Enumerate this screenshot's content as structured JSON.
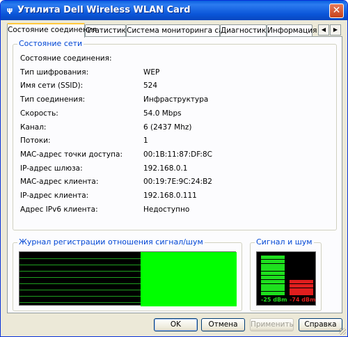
{
  "window": {
    "title": "Утилита Dell Wireless WLAN Card",
    "close_glyph": "✕",
    "app_icon_glyph": "ψ"
  },
  "tabs": [
    {
      "label": "Состояние соединения",
      "active": true
    },
    {
      "label": "Статистика",
      "active": false
    },
    {
      "label": "Система мониторинга сайта",
      "active": false
    },
    {
      "label": "Диагностика",
      "active": false
    },
    {
      "label": "Информация",
      "active": false
    }
  ],
  "tab_scroll": {
    "left_glyph": "◀",
    "right_glyph": "▶"
  },
  "network_status": {
    "legend": "Состояние сети",
    "rows": [
      {
        "label": "Состояние соединения:",
        "value": ""
      },
      {
        "label": "Тип шифрования:",
        "value": "WEP"
      },
      {
        "label": "Имя сети (SSID):",
        "value": "524"
      },
      {
        "label": "Тип соединения:",
        "value": "Инфраструктура"
      },
      {
        "label": "Скорость:",
        "value": "54.0 Mbps"
      },
      {
        "label": "Канал:",
        "value": "6 (2437 Mhz)"
      },
      {
        "label": "Потоки:",
        "value": "1"
      },
      {
        "label": "MAC-адрес точки доступа:",
        "value": "00:1B:11:87:DF:8C"
      },
      {
        "label": "IP-адрес шлюза:",
        "value": "192.168.0.1"
      },
      {
        "label": "MAC-адрес клиента:",
        "value": "00:19:7E:9C:24:B2"
      },
      {
        "label": "IP-адрес клиента:",
        "value": "192.168.0.111"
      },
      {
        "label": "Адрес IPv6 клиента:",
        "value": "Недоступно"
      }
    ]
  },
  "snr_log": {
    "legend": "Журнал регистрации отношения сигнал/шум"
  },
  "signal_noise": {
    "legend": "Сигнал и шум",
    "signal_label": "-25 dBm",
    "noise_label": "-74 dBm",
    "signal_bars_lit": 10,
    "noise_bars_lit": 4,
    "signal_color": "#1ee01e",
    "noise_color": "#e01e1e"
  },
  "buttons": {
    "ok": "OK",
    "cancel": "Отмена",
    "apply": "Применить",
    "help": "Справка"
  }
}
